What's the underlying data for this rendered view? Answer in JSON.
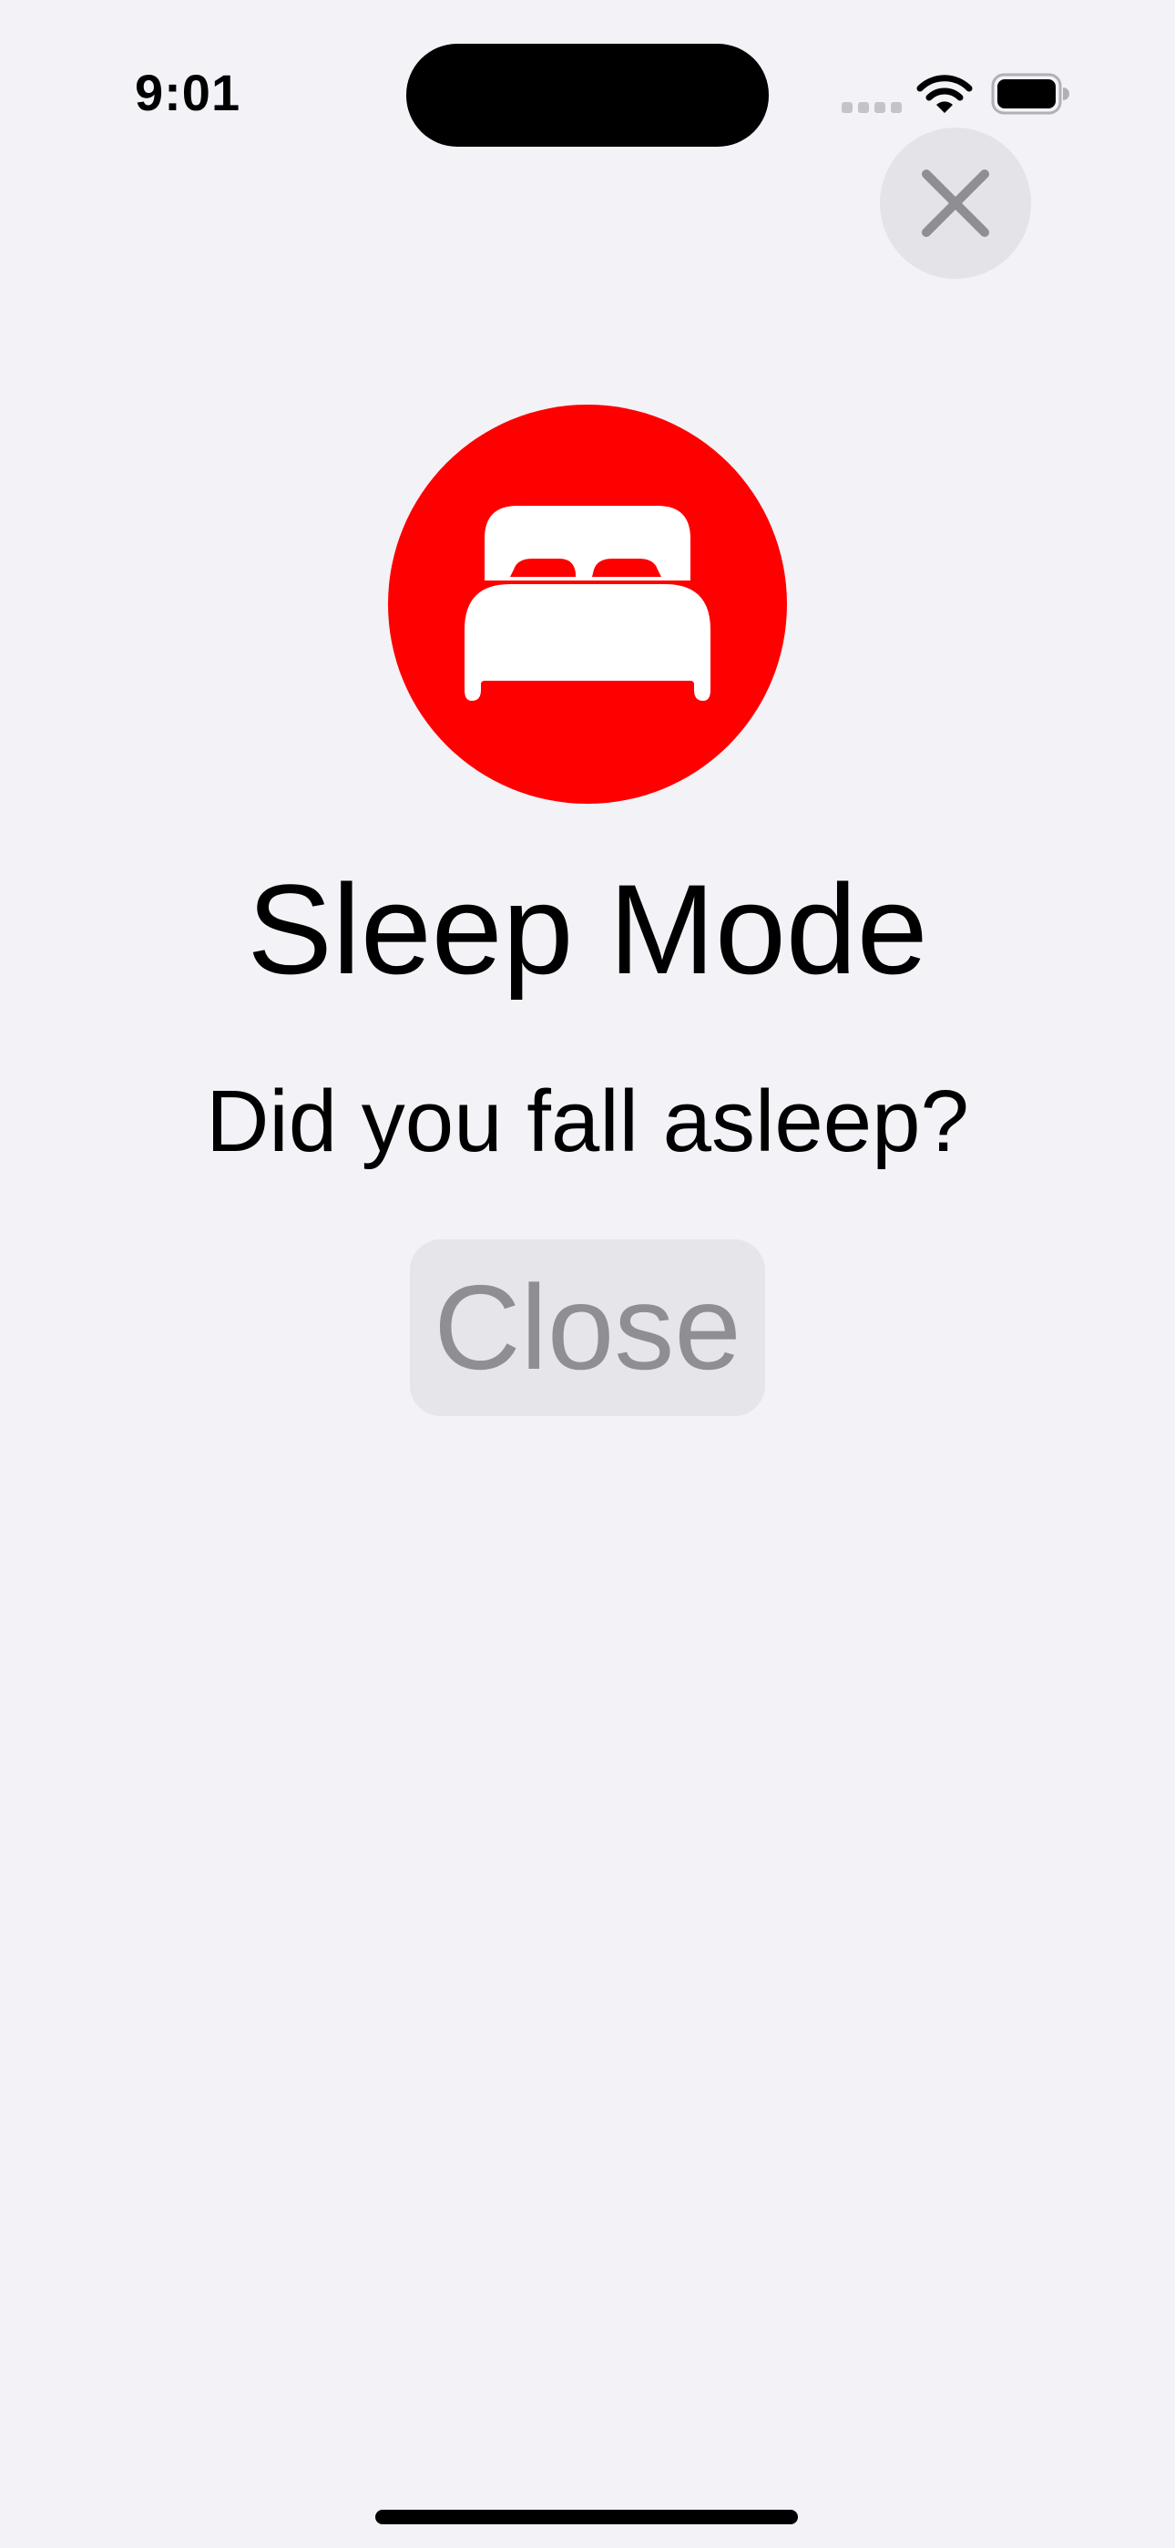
{
  "status_bar": {
    "time": "9:01",
    "icons": [
      "cellular-signal-icon",
      "wifi-icon",
      "battery-icon"
    ]
  },
  "dismiss_button": {
    "icon": "close-icon"
  },
  "hero": {
    "icon": "bed-icon",
    "background_color": "#ff0000"
  },
  "title": "Sleep Mode",
  "subtitle": "Did you fall asleep?",
  "close_button": {
    "label": "Close"
  }
}
